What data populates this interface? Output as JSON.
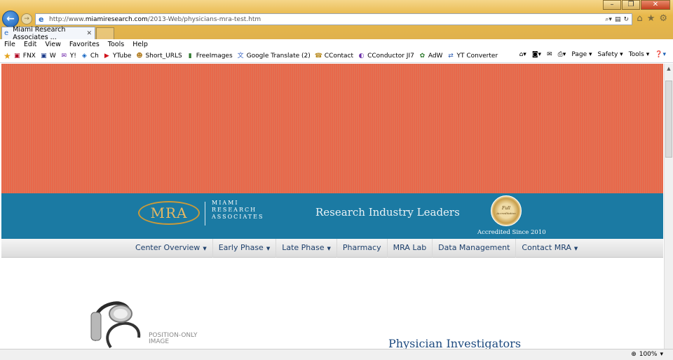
{
  "browser": {
    "address_url_prefix": "http://www.",
    "address_url_domain": "miamiresearch.com",
    "address_url_path": "/2013-Web/physicians-mra-test.htm",
    "tab_title": "Miami Research Associates ...",
    "window_controls": [
      "–",
      "❐",
      "✕"
    ],
    "nav_icons": {
      "back": "back-arrow-icon",
      "forward": "forward-arrow-icon"
    }
  },
  "menubar": {
    "items": [
      "File",
      "Edit",
      "View",
      "Favorites",
      "Tools",
      "Help"
    ]
  },
  "favorites": {
    "items": [
      {
        "label": "FNX",
        "icon": "fnx-icon",
        "glyph": "▣",
        "color": "#b00020"
      },
      {
        "label": "W",
        "icon": "weather-icon",
        "glyph": "▣",
        "color": "#1a3a8a"
      },
      {
        "label": "Y!",
        "icon": "yahoo-icon",
        "glyph": "✉",
        "color": "#6b1fa8"
      },
      {
        "label": "Ch",
        "icon": "chase-icon",
        "glyph": "◈",
        "color": "#0b5fc0"
      },
      {
        "label": "YTube",
        "icon": "youtube-icon",
        "glyph": "▶",
        "color": "#d0121b"
      },
      {
        "label": "Short_URLS",
        "icon": "bookmark-icon",
        "glyph": "☻",
        "color": "#b5832c"
      },
      {
        "label": "FreeImages",
        "icon": "freeimages-icon",
        "glyph": "▮",
        "color": "#2f7a2f"
      },
      {
        "label": "Google Translate (2)",
        "icon": "translate-icon",
        "glyph": "文",
        "color": "#3a66c4"
      },
      {
        "label": "CContact",
        "icon": "ccontact-icon",
        "glyph": "☎",
        "color": "#b88a1f"
      },
      {
        "label": "CConductor JI7",
        "icon": "cconductor-icon",
        "glyph": "◐",
        "color": "#6a2fa8"
      },
      {
        "label": "AdW",
        "icon": "adwords-icon",
        "glyph": "✿",
        "color": "#2c7a2c"
      },
      {
        "label": "YT Converter",
        "icon": "converter-icon",
        "glyph": "⇄",
        "color": "#2a5ab0"
      }
    ]
  },
  "commandbar": {
    "page_label": "Page",
    "safety_label": "Safety",
    "tools_label": "Tools"
  },
  "site": {
    "logo_mark": "MRA",
    "logo_words": [
      "MIAMI",
      "RESEARCH",
      "ASSOCIATES"
    ],
    "tagline": "Research Industry Leaders",
    "seal_text": "Full",
    "seal_subtext": "Accreditation",
    "accredited": "Accredited Since 2010",
    "nav": [
      {
        "label": "Center Overview",
        "dropdown": true
      },
      {
        "label": "Early Phase",
        "dropdown": true
      },
      {
        "label": "Late Phase",
        "dropdown": true
      },
      {
        "label": "Pharmacy",
        "dropdown": false
      },
      {
        "label": "MRA Lab",
        "dropdown": false
      },
      {
        "label": "Data Management",
        "dropdown": false
      },
      {
        "label": "Contact MRA",
        "dropdown": true
      }
    ],
    "position_only": [
      "POSITION-ONLY",
      "IMAGE"
    ],
    "heading": "Physician Investigators",
    "colors": {
      "banner": "#e8684a",
      "band": "#1b7aa3",
      "nav_text": "#1d3f6b",
      "heading": "#1d4a7f"
    }
  },
  "statusbar": {
    "zoom": "100%"
  }
}
